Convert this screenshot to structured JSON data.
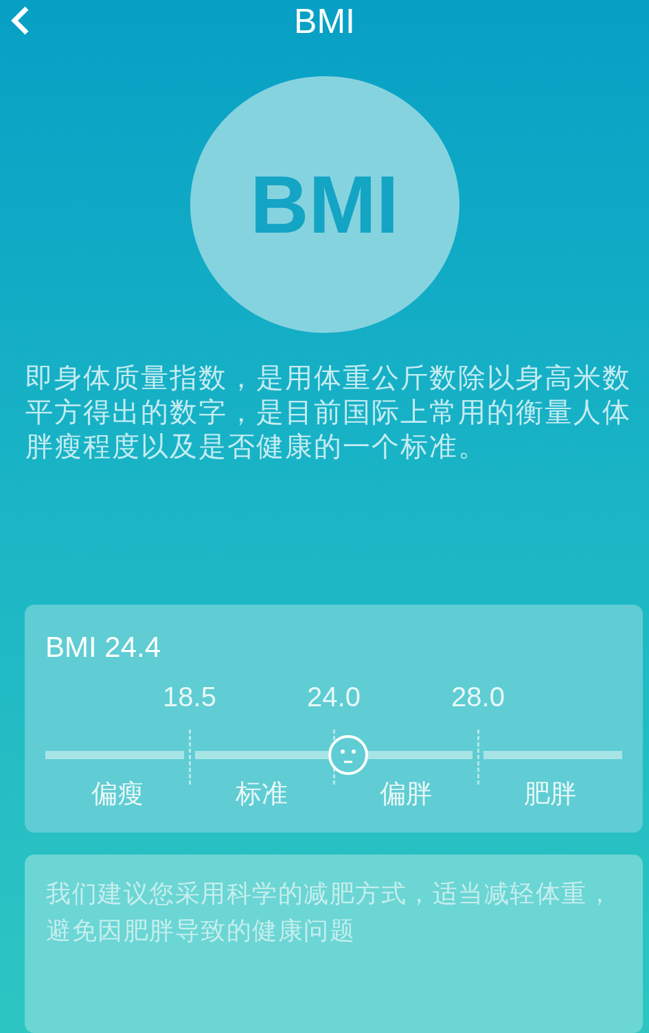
{
  "header": {
    "title": "BMI"
  },
  "badge": {
    "text": "BMI"
  },
  "description": "即身体质量指数，是用体重公斤数除以身高米数平方得出的数字，是目前国际上常用的衡量人体胖瘦程度以及是否健康的一个标准。",
  "result": {
    "value_label": "BMI 24.4",
    "thresholds": [
      "18.5",
      "24.0",
      "28.0"
    ],
    "categories": [
      "偏瘦",
      "标准",
      "偏胖",
      "肥胖"
    ],
    "level": 0.525
  },
  "advice": "我们建议您采用科学的减肥方式，适当减轻体重，避免因肥胖导致的健康问题"
}
